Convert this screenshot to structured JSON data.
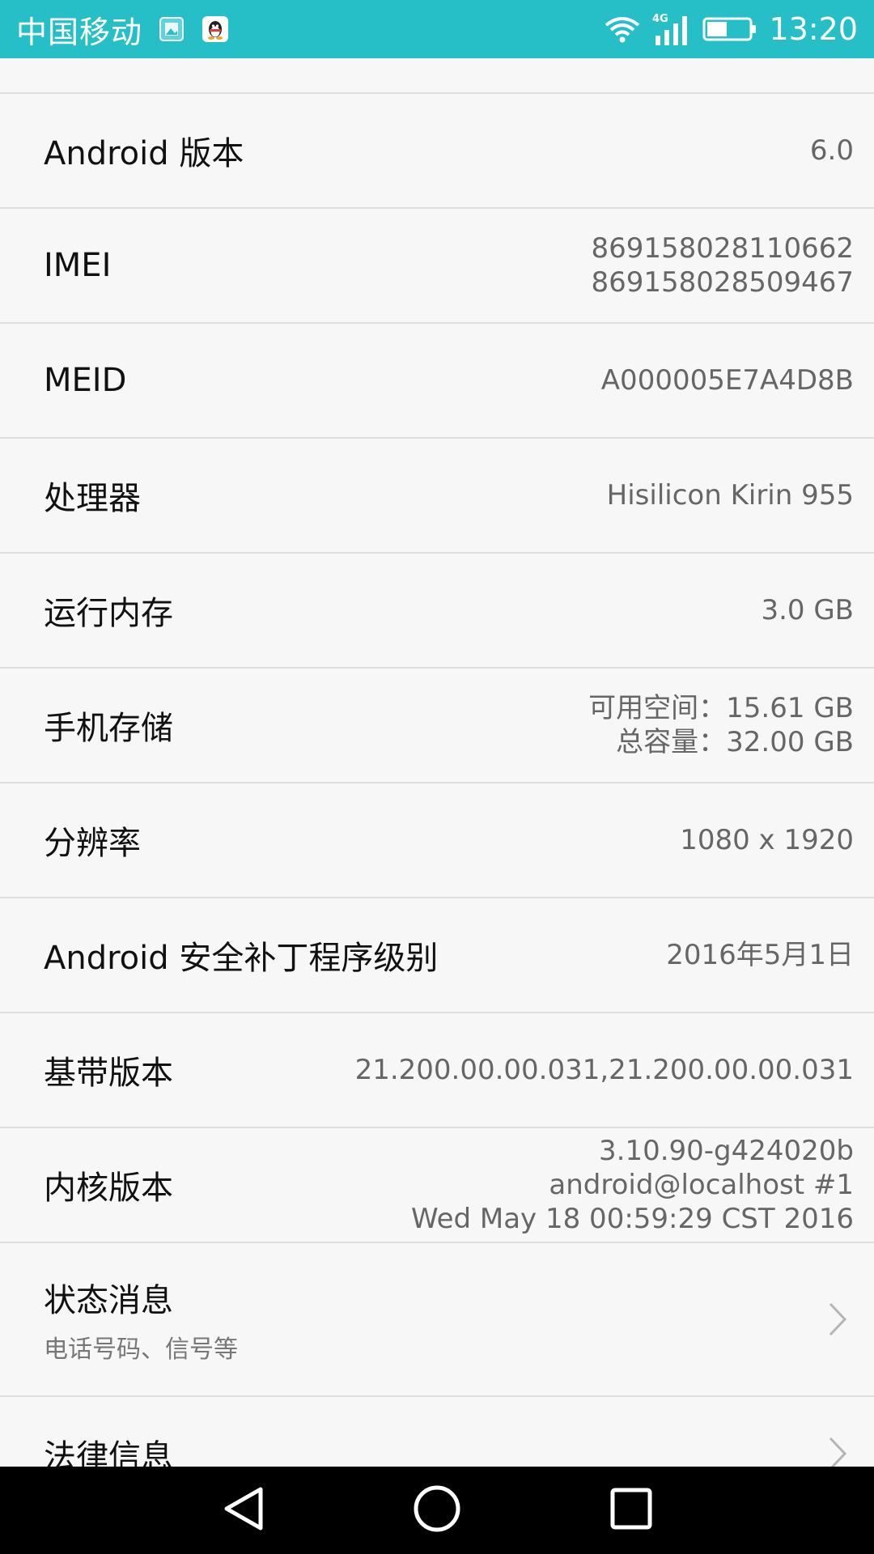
{
  "status_bar": {
    "carrier": "中国移动",
    "network": "4G",
    "time": "13:20",
    "notification_icons": [
      "image-icon",
      "qq-icon"
    ],
    "right_icons": [
      "wifi-icon",
      "signal-icon",
      "battery-icon"
    ],
    "color": "#26bfc7"
  },
  "rows": [
    {
      "label": "Android 版本",
      "value": [
        "6.0"
      ]
    },
    {
      "label": "IMEI",
      "value": [
        "869158028110662",
        "869158028509467"
      ]
    },
    {
      "label": "MEID",
      "value": [
        "A000005E7A4D8B"
      ]
    },
    {
      "label": "处理器",
      "value": [
        "Hisilicon Kirin 955"
      ]
    },
    {
      "label": "运行内存",
      "value": [
        "3.0 GB"
      ]
    },
    {
      "label": "手机存储",
      "value": [
        "可用空间：15.61  GB",
        "总容量：32.00  GB"
      ]
    },
    {
      "label": "分辨率",
      "value": [
        "1080 x 1920"
      ]
    },
    {
      "label": "Android 安全补丁程序级别",
      "value": [
        "2016年5月1日"
      ]
    },
    {
      "label": "基带版本",
      "value": [
        "21.200.00.00.031,21.200.00.00.031"
      ]
    },
    {
      "label": "内核版本",
      "value": [
        "3.10.90-g424020b",
        "android@localhost #1",
        "Wed May 18 00:59:29 CST 2016"
      ]
    }
  ],
  "nav_rows": [
    {
      "label": "状态消息",
      "sublabel": "电话号码、信号等",
      "icon": "chevron-right-icon"
    },
    {
      "label": "法律信息",
      "sublabel": "",
      "icon": "chevron-right-icon"
    }
  ],
  "navbar": {
    "buttons": [
      "back-icon",
      "home-icon",
      "recents-icon"
    ]
  }
}
